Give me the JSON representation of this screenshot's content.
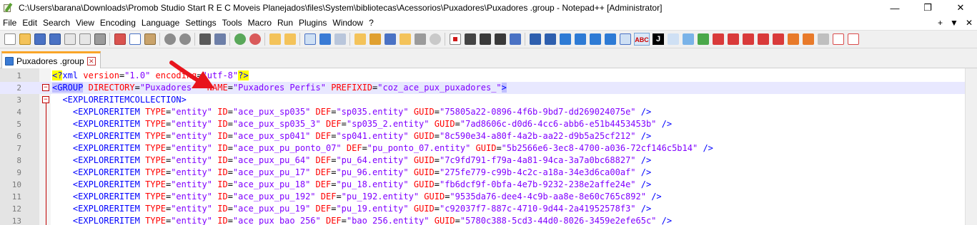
{
  "window": {
    "title": "C:\\Users\\barana\\Downloads\\Promob Studio Start R E C Moveis Planejados\\files\\System\\bibliotecas\\Acessorios\\Puxadores\\Puxadores .group - Notepad++ [Administrator]",
    "minimize": "—",
    "maximize": "❐",
    "close": "✕"
  },
  "menu": {
    "items": [
      "File",
      "Edit",
      "Search",
      "View",
      "Encoding",
      "Language",
      "Settings",
      "Tools",
      "Macro",
      "Run",
      "Plugins",
      "Window",
      "?"
    ],
    "right_plus": "+",
    "right_dropdown": "▼",
    "right_close": "✕"
  },
  "tab": {
    "label": "Puxadores .group",
    "close": "✕"
  },
  "editor": {
    "line_numbers": [
      "1",
      "2",
      "3",
      "4",
      "5",
      "6",
      "7",
      "8",
      "9",
      "10",
      "11",
      "12",
      "13"
    ],
    "lines": [
      {
        "parts": [
          [
            "pi",
            "<?"
          ],
          [
            "tag",
            "xml "
          ],
          [
            "attr",
            "version"
          ],
          [
            "plain",
            "="
          ],
          [
            "str",
            "\"1.0\""
          ],
          [
            "plain",
            " "
          ],
          [
            "attr",
            "encoding"
          ],
          [
            "plain",
            "="
          ],
          [
            "str",
            "\"utf-8\""
          ],
          [
            "pi",
            "?>"
          ]
        ]
      },
      {
        "parts": [
          [
            "hl",
            "<GROUP"
          ],
          [
            "plain",
            " "
          ],
          [
            "attr",
            "DIRECTORY"
          ],
          [
            "plain",
            "="
          ],
          [
            "str",
            "\"Puxadores \""
          ],
          [
            "plain",
            " "
          ],
          [
            "attr",
            "NAME"
          ],
          [
            "plain",
            "="
          ],
          [
            "str",
            "\"Puxadores Perfis\""
          ],
          [
            "plain",
            " "
          ],
          [
            "attr",
            "PREFIXID"
          ],
          [
            "plain",
            "="
          ],
          [
            "str",
            "\"coz_ace_pux_puxadores_\""
          ],
          [
            "hltag",
            ">"
          ]
        ]
      },
      {
        "parts": [
          [
            "plain",
            "  "
          ],
          [
            "tag",
            "<EXPLORERITEMCOLLECTION>"
          ]
        ]
      },
      {
        "parts": [
          [
            "plain",
            "    "
          ],
          [
            "tag",
            "<EXPLORERITEM "
          ],
          [
            "attr",
            "TYPE"
          ],
          [
            "plain",
            "="
          ],
          [
            "str",
            "\"entity\""
          ],
          [
            "plain",
            " "
          ],
          [
            "attr",
            "ID"
          ],
          [
            "plain",
            "="
          ],
          [
            "str",
            "\"ace_pux_sp035\""
          ],
          [
            "plain",
            " "
          ],
          [
            "attr",
            "DEF"
          ],
          [
            "plain",
            "="
          ],
          [
            "str",
            "\"sp035.entity\""
          ],
          [
            "plain",
            " "
          ],
          [
            "attr",
            "GUID"
          ],
          [
            "plain",
            "="
          ],
          [
            "str",
            "\"75805a22-0896-4f6b-9bd7-dd269024075e\""
          ],
          [
            "plain",
            " "
          ],
          [
            "tag",
            "/>"
          ]
        ]
      },
      {
        "parts": [
          [
            "plain",
            "    "
          ],
          [
            "tag",
            "<EXPLORERITEM "
          ],
          [
            "attr",
            "TYPE"
          ],
          [
            "plain",
            "="
          ],
          [
            "str",
            "\"entity\""
          ],
          [
            "plain",
            " "
          ],
          [
            "attr",
            "ID"
          ],
          [
            "plain",
            "="
          ],
          [
            "str",
            "\"ace_pux_sp035_3\""
          ],
          [
            "plain",
            " "
          ],
          [
            "attr",
            "DEF"
          ],
          [
            "plain",
            "="
          ],
          [
            "str",
            "\"sp035_2.entity\""
          ],
          [
            "plain",
            " "
          ],
          [
            "attr",
            "GUID"
          ],
          [
            "plain",
            "="
          ],
          [
            "str",
            "\"7ad8606c-d0d6-4cc6-abb6-e51b4453453b\""
          ],
          [
            "plain",
            " "
          ],
          [
            "tag",
            "/>"
          ]
        ]
      },
      {
        "parts": [
          [
            "plain",
            "    "
          ],
          [
            "tag",
            "<EXPLORERITEM "
          ],
          [
            "attr",
            "TYPE"
          ],
          [
            "plain",
            "="
          ],
          [
            "str",
            "\"entity\""
          ],
          [
            "plain",
            " "
          ],
          [
            "attr",
            "ID"
          ],
          [
            "plain",
            "="
          ],
          [
            "str",
            "\"ace_pux_sp041\""
          ],
          [
            "plain",
            " "
          ],
          [
            "attr",
            "DEF"
          ],
          [
            "plain",
            "="
          ],
          [
            "str",
            "\"sp041.entity\""
          ],
          [
            "plain",
            " "
          ],
          [
            "attr",
            "GUID"
          ],
          [
            "plain",
            "="
          ],
          [
            "str",
            "\"8c590e34-a80f-4a2b-aa22-d9b5a25cf212\""
          ],
          [
            "plain",
            " "
          ],
          [
            "tag",
            "/>"
          ]
        ]
      },
      {
        "parts": [
          [
            "plain",
            "    "
          ],
          [
            "tag",
            "<EXPLORERITEM "
          ],
          [
            "attr",
            "TYPE"
          ],
          [
            "plain",
            "="
          ],
          [
            "str",
            "\"entity\""
          ],
          [
            "plain",
            " "
          ],
          [
            "attr",
            "ID"
          ],
          [
            "plain",
            "="
          ],
          [
            "str",
            "\"ace_pux_pu_ponto_07\""
          ],
          [
            "plain",
            " "
          ],
          [
            "attr",
            "DEF"
          ],
          [
            "plain",
            "="
          ],
          [
            "str",
            "\"pu_ponto_07.entity\""
          ],
          [
            "plain",
            " "
          ],
          [
            "attr",
            "GUID"
          ],
          [
            "plain",
            "="
          ],
          [
            "str",
            "\"5b2566e6-3ec8-4700-a036-72cf146c5b14\""
          ],
          [
            "plain",
            " "
          ],
          [
            "tag",
            "/>"
          ]
        ]
      },
      {
        "parts": [
          [
            "plain",
            "    "
          ],
          [
            "tag",
            "<EXPLORERITEM "
          ],
          [
            "attr",
            "TYPE"
          ],
          [
            "plain",
            "="
          ],
          [
            "str",
            "\"entity\""
          ],
          [
            "plain",
            " "
          ],
          [
            "attr",
            "ID"
          ],
          [
            "plain",
            "="
          ],
          [
            "str",
            "\"ace_pux_pu_64\""
          ],
          [
            "plain",
            " "
          ],
          [
            "attr",
            "DEF"
          ],
          [
            "plain",
            "="
          ],
          [
            "str",
            "\"pu_64.entity\""
          ],
          [
            "plain",
            " "
          ],
          [
            "attr",
            "GUID"
          ],
          [
            "plain",
            "="
          ],
          [
            "str",
            "\"7c9fd791-f79a-4a81-94ca-3a7a0bc68827\""
          ],
          [
            "plain",
            " "
          ],
          [
            "tag",
            "/>"
          ]
        ]
      },
      {
        "parts": [
          [
            "plain",
            "    "
          ],
          [
            "tag",
            "<EXPLORERITEM "
          ],
          [
            "attr",
            "TYPE"
          ],
          [
            "plain",
            "="
          ],
          [
            "str",
            "\"entity\""
          ],
          [
            "plain",
            " "
          ],
          [
            "attr",
            "ID"
          ],
          [
            "plain",
            "="
          ],
          [
            "str",
            "\"ace_pux_pu_17\""
          ],
          [
            "plain",
            " "
          ],
          [
            "attr",
            "DEF"
          ],
          [
            "plain",
            "="
          ],
          [
            "str",
            "\"pu_96.entity\""
          ],
          [
            "plain",
            " "
          ],
          [
            "attr",
            "GUID"
          ],
          [
            "plain",
            "="
          ],
          [
            "str",
            "\"275fe779-c99b-4c2c-a18a-34e3d6ca00af\""
          ],
          [
            "plain",
            " "
          ],
          [
            "tag",
            "/>"
          ]
        ]
      },
      {
        "parts": [
          [
            "plain",
            "    "
          ],
          [
            "tag",
            "<EXPLORERITEM "
          ],
          [
            "attr",
            "TYPE"
          ],
          [
            "plain",
            "="
          ],
          [
            "str",
            "\"entity\""
          ],
          [
            "plain",
            " "
          ],
          [
            "attr",
            "ID"
          ],
          [
            "plain",
            "="
          ],
          [
            "str",
            "\"ace_pux_pu_18\""
          ],
          [
            "plain",
            " "
          ],
          [
            "attr",
            "DEF"
          ],
          [
            "plain",
            "="
          ],
          [
            "str",
            "\"pu_18.entity\""
          ],
          [
            "plain",
            " "
          ],
          [
            "attr",
            "GUID"
          ],
          [
            "plain",
            "="
          ],
          [
            "str",
            "\"fb6dcf9f-0bfa-4e7b-9232-238e2affe24e\""
          ],
          [
            "plain",
            " "
          ],
          [
            "tag",
            "/>"
          ]
        ]
      },
      {
        "parts": [
          [
            "plain",
            "    "
          ],
          [
            "tag",
            "<EXPLORERITEM "
          ],
          [
            "attr",
            "TYPE"
          ],
          [
            "plain",
            "="
          ],
          [
            "str",
            "\"entity\""
          ],
          [
            "plain",
            " "
          ],
          [
            "attr",
            "ID"
          ],
          [
            "plain",
            "="
          ],
          [
            "str",
            "\"ace_pux_pu_192\""
          ],
          [
            "plain",
            " "
          ],
          [
            "attr",
            "DEF"
          ],
          [
            "plain",
            "="
          ],
          [
            "str",
            "\"pu_192.entity\""
          ],
          [
            "plain",
            " "
          ],
          [
            "attr",
            "GUID"
          ],
          [
            "plain",
            "="
          ],
          [
            "str",
            "\"9535da76-dee4-4c9b-aa8e-8e60c765c892\""
          ],
          [
            "plain",
            " "
          ],
          [
            "tag",
            "/>"
          ]
        ]
      },
      {
        "parts": [
          [
            "plain",
            "    "
          ],
          [
            "tag",
            "<EXPLORERITEM "
          ],
          [
            "attr",
            "TYPE"
          ],
          [
            "plain",
            "="
          ],
          [
            "str",
            "\"entity\""
          ],
          [
            "plain",
            " "
          ],
          [
            "attr",
            "ID"
          ],
          [
            "plain",
            "="
          ],
          [
            "str",
            "\"ace_pux_pu_19\""
          ],
          [
            "plain",
            " "
          ],
          [
            "attr",
            "DEF"
          ],
          [
            "plain",
            "="
          ],
          [
            "str",
            "\"pu_19.entity\""
          ],
          [
            "plain",
            " "
          ],
          [
            "attr",
            "GUID"
          ],
          [
            "plain",
            "="
          ],
          [
            "str",
            "\"c92037f7-887c-4710-9d44-2a41952578f3\""
          ],
          [
            "plain",
            " "
          ],
          [
            "tag",
            "/>"
          ]
        ]
      },
      {
        "parts": [
          [
            "plain",
            "    "
          ],
          [
            "tag",
            "<EXPLORERITEM "
          ],
          [
            "attr",
            "TYPE"
          ],
          [
            "plain",
            "="
          ],
          [
            "str",
            "\"entity\""
          ],
          [
            "plain",
            " "
          ],
          [
            "attr",
            "ID"
          ],
          [
            "plain",
            "="
          ],
          [
            "str",
            "\"ace_pux_bao_256\""
          ],
          [
            "plain",
            " "
          ],
          [
            "attr",
            "DEF"
          ],
          [
            "plain",
            "="
          ],
          [
            "str",
            "\"bao_256.entity\""
          ],
          [
            "plain",
            " "
          ],
          [
            "attr",
            "GUID"
          ],
          [
            "plain",
            "="
          ],
          [
            "str",
            "\"5780c388-5cd3-44d0-8026-3459e2efe65c\""
          ],
          [
            "plain",
            " "
          ],
          [
            "tag",
            "/>"
          ]
        ]
      }
    ]
  },
  "colors": {
    "tag": "#0000ff",
    "attr": "#ff0000",
    "str": "#8000ff",
    "annotation_arrow": "#e8141c",
    "tab_accent": "#f9a528"
  },
  "icons": [
    "app-notepad-icon",
    "file-icon",
    "new-file-icon",
    "open-icon",
    "save-icon",
    "save-all-icon",
    "close-icon",
    "close-all-icon",
    "print-icon",
    "cut-icon",
    "copy-icon",
    "paste-icon",
    "undo-icon",
    "redo-icon",
    "find-icon",
    "replace-icon",
    "zoom-in-icon",
    "zoom-out-icon",
    "sync-v-icon",
    "sync-h-icon",
    "wrap-icon",
    "all-chars-icon",
    "indent-guide-icon",
    "udl-icon",
    "doc-map-icon",
    "function-list-icon",
    "folder-workspace-icon",
    "monitor-icon",
    "record-macro-icon",
    "stop-macro-icon",
    "play-macro-icon",
    "run-macro-multiple-icon",
    "save-macro-icon",
    "spell-check-icon",
    "json-icon"
  ]
}
